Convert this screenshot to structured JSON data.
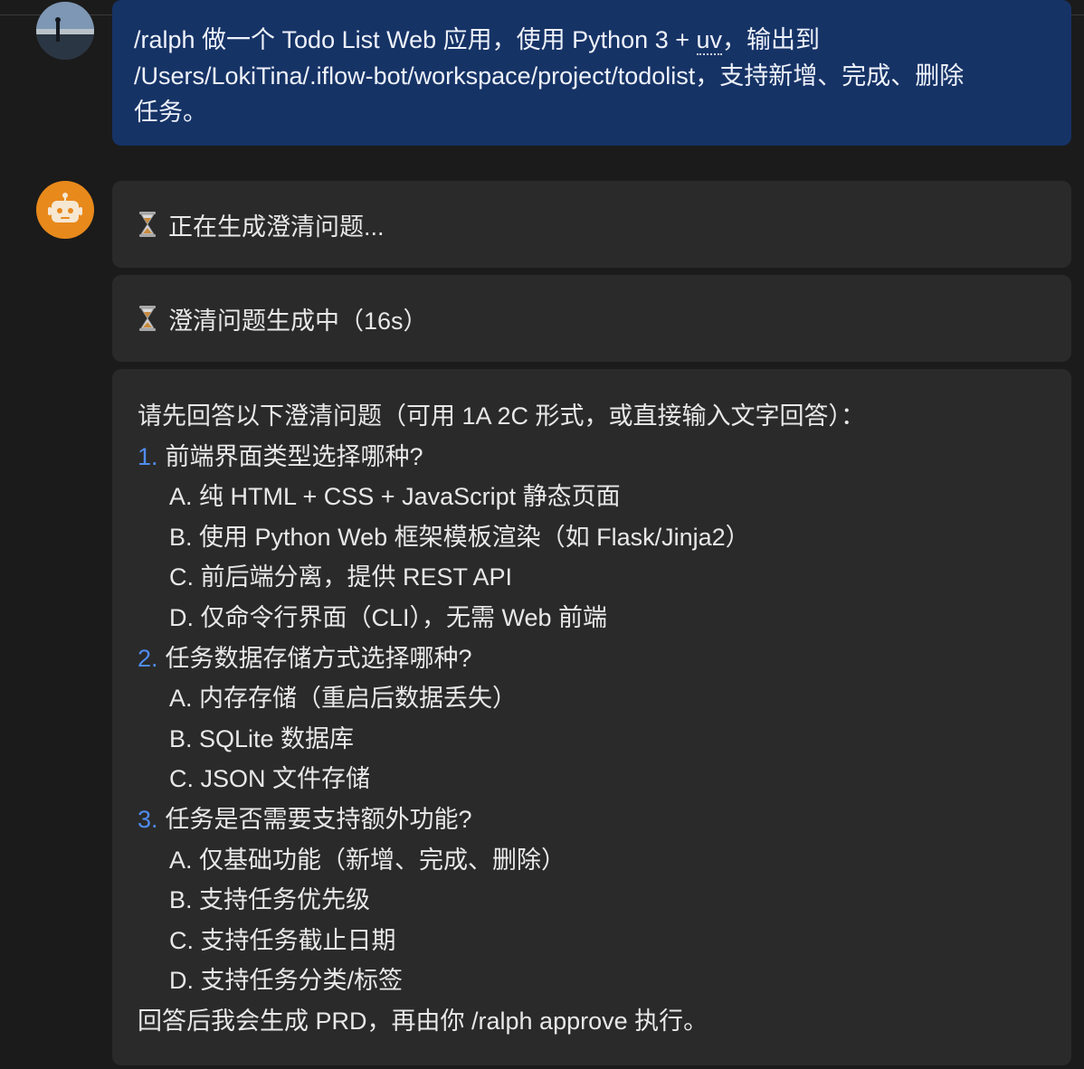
{
  "user_message": {
    "line1_before": "/ralph 做一个 Todo List Web 应用，使用 Python 3 + ",
    "line1_uv": "uv",
    "line1_after": "，输出到",
    "line2": "/Users/LokiTina/.iflow-bot/workspace/project/todolist，支持新增、完成、删除",
    "line3": "任务。"
  },
  "status_messages": [
    {
      "text": "正在生成澄清问题..."
    },
    {
      "text": "澄清问题生成中（16s）"
    }
  ],
  "answer": {
    "intro": "请先回答以下澄清问题（可用 1A 2C 形式，或直接输入文字回答）：",
    "questions": [
      {
        "number": "1.",
        "text": "前端界面类型选择哪种?",
        "options": [
          "A. 纯 HTML + CSS + JavaScript 静态页面",
          "B. 使用 Python Web 框架模板渲染（如 Flask/Jinja2）",
          "C. 前后端分离，提供 REST API",
          "D. 仅命令行界面（CLI），无需 Web 前端"
        ]
      },
      {
        "number": "2.",
        "text": "任务数据存储方式选择哪种?",
        "options": [
          "A. 内存存储（重启后数据丢失）",
          "B. SQLite 数据库",
          "C. JSON 文件存储"
        ]
      },
      {
        "number": "3.",
        "text": "任务是否需要支持额外功能?",
        "options": [
          "A. 仅基础功能（新增、完成、删除）",
          "B. 支持任务优先级",
          "C. 支持任务截止日期",
          "D. 支持任务分类/标签"
        ]
      }
    ],
    "footer": "回答后我会生成 PRD，再由你 /ralph approve 执行。"
  },
  "colors": {
    "background": "#1b1b1b",
    "user_bubble": "#163366",
    "assistant_bubble": "#2a2a2a",
    "question_number": "#4f8cf0",
    "bot_avatar": "#e8891c"
  },
  "icons": {
    "user_avatar": "user-photo-avatar",
    "bot_avatar": "robot-icon",
    "status": "hourglass-icon"
  }
}
